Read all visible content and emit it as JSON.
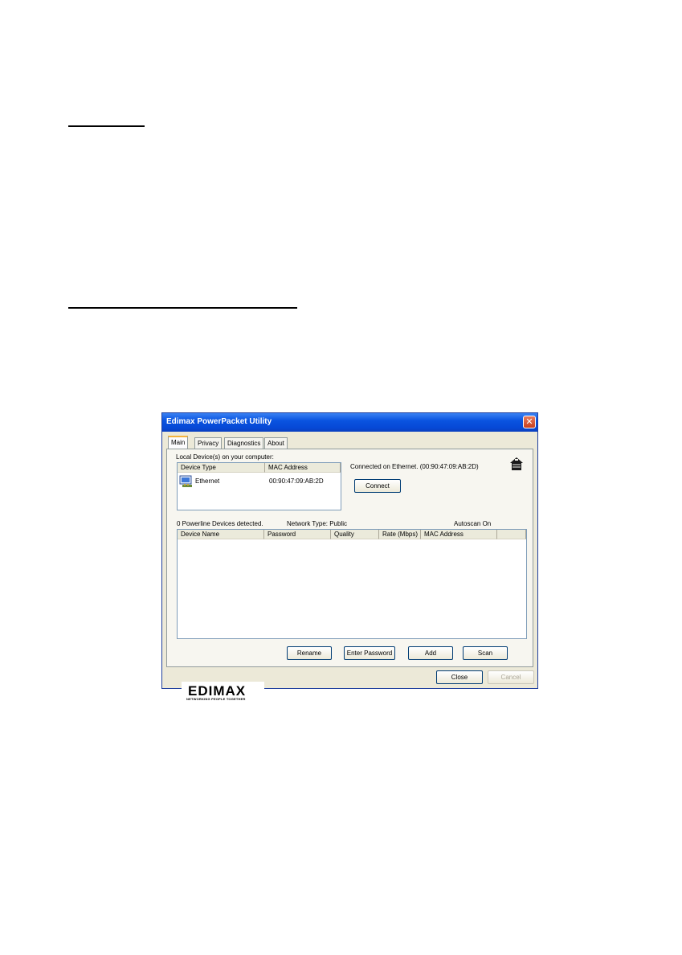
{
  "window": {
    "title": "Edimax PowerPacket Utility",
    "close_glyph": "✕"
  },
  "tabs": [
    {
      "label": "Main",
      "active": true
    },
    {
      "label": "Privacy",
      "active": false
    },
    {
      "label": "Diagnostics",
      "active": false
    },
    {
      "label": "About",
      "active": false
    }
  ],
  "local": {
    "heading": "Local Device(s) on your computer:",
    "columns": [
      "Device Type",
      "MAC Address"
    ],
    "rows": [
      {
        "icon": "network-adapter-icon",
        "device_type": "Ethernet",
        "mac": "00:90:47:09:AB:2D"
      }
    ],
    "status": "Connected on Ethernet. (00:90:47:09:AB:2D)",
    "connect_label": "Connect",
    "house_icon": "house-icon"
  },
  "powerline": {
    "detected": "0 Powerline Devices detected.",
    "network_type": "Network Type: Public",
    "autoscan": "Autoscan On",
    "columns": [
      "Device Name",
      "Password",
      "Quality",
      "Rate (Mbps)",
      "MAC Address"
    ],
    "rows": []
  },
  "buttons": {
    "rename": "Rename",
    "enter_password": "Enter Password",
    "add": "Add",
    "scan": "Scan",
    "close": "Close",
    "cancel": "Cancel"
  },
  "logo": {
    "word": "EDIMAX",
    "tagline": "NETWORKING PEOPLE TOGETHER"
  },
  "colors": {
    "titlebar": "#0a54e0",
    "window_bg": "#ece9d8",
    "active_tab_accent": "#f3b33d"
  }
}
